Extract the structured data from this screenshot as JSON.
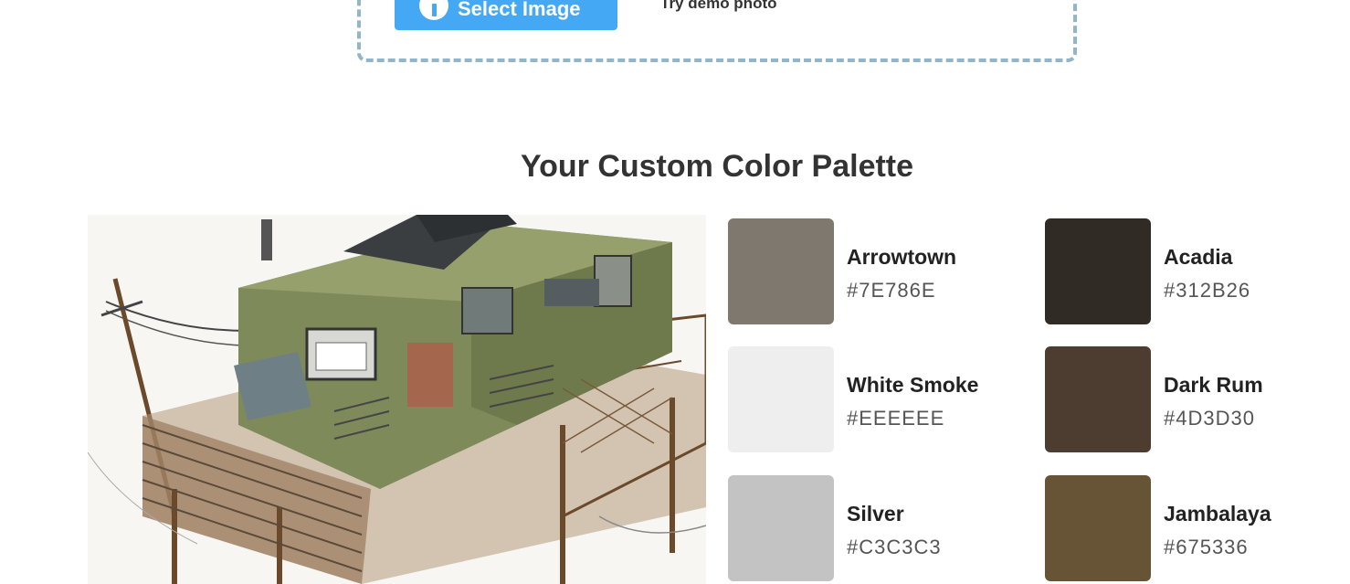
{
  "upload": {
    "select_label": "Select Image",
    "demo_label": "Try demo photo"
  },
  "palette": {
    "title": "Your Custom Color Palette",
    "colors": [
      {
        "name": "Arrowtown",
        "hex": "#7E786E"
      },
      {
        "name": "Acadia",
        "hex": "#312B26"
      },
      {
        "name": "White Smoke",
        "hex": "#EEEEEE"
      },
      {
        "name": "Dark Rum",
        "hex": "#4D3D30"
      },
      {
        "name": "Silver",
        "hex": "#C3C3C3"
      },
      {
        "name": "Jambalaya",
        "hex": "#675336"
      }
    ]
  },
  "colors": {
    "accent": "#44A8F5",
    "dropzone_border": "#91B5CB"
  }
}
